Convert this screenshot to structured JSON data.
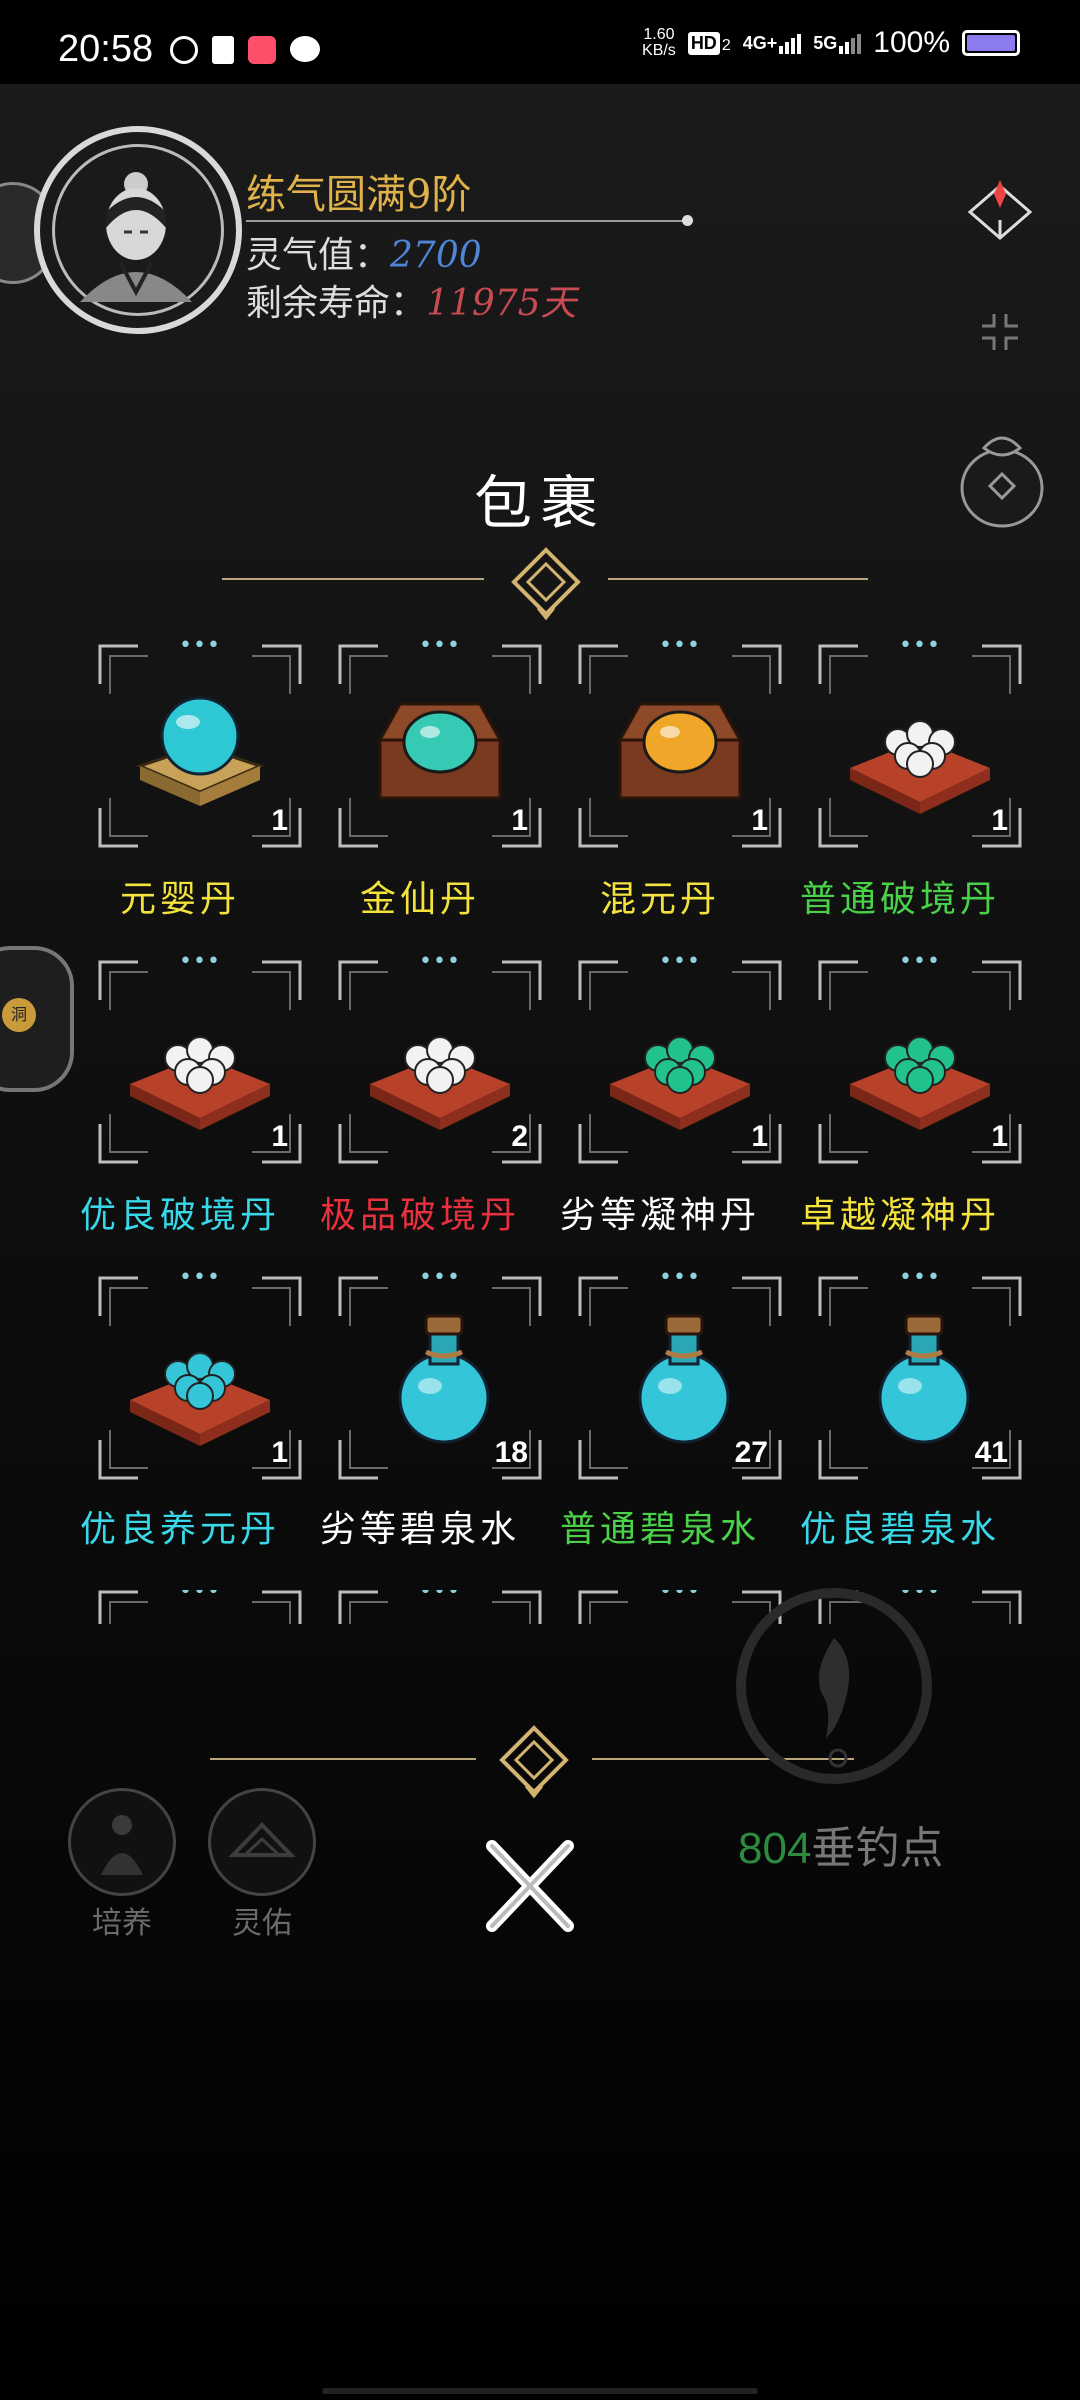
{
  "status_bar": {
    "time": "20:58",
    "net_speed_value": "1.60",
    "net_speed_unit": "KB/s",
    "hd": "HD",
    "hd_sub": "2",
    "sig1": "4G+",
    "sig2": "5G",
    "battery": "100%"
  },
  "player": {
    "rank": "练气圆满9阶",
    "spirit_label": "灵气值：",
    "spirit_value": "2700",
    "life_label": "剩余寿命：",
    "life_value": "11975天"
  },
  "side_tab_label": "洞",
  "panel": {
    "title": "包裹",
    "items": [
      {
        "name": "元婴丹",
        "count": "1",
        "color": "#f3e33c",
        "kind": "orb-box",
        "icon": "cyan-orb-on-box-icon"
      },
      {
        "name": "金仙丹",
        "count": "1",
        "color": "#f3e33c",
        "kind": "chest",
        "orb": "#36c9b4",
        "icon": "teal-orb-chest-icon"
      },
      {
        "name": "混元丹",
        "count": "1",
        "color": "#f3e33c",
        "kind": "chest",
        "orb": "#f0a628",
        "icon": "gold-orb-chest-icon"
      },
      {
        "name": "普通破境丹",
        "count": "1",
        "color": "#4ad14a",
        "kind": "pills",
        "pill": "#f2f2f2",
        "icon": "white-pills-cushion-icon"
      },
      {
        "name": "优良破境丹",
        "count": "1",
        "color": "#38d8e8",
        "kind": "pills",
        "pill": "#f2f2f2",
        "icon": "white-pills-cushion-icon"
      },
      {
        "name": "极品破境丹",
        "count": "2",
        "color": "#e8303e",
        "kind": "pills",
        "pill": "#f2f2f2",
        "icon": "white-pills-cushion-icon"
      },
      {
        "name": "劣等凝神丹",
        "count": "1",
        "color": "#ffffff",
        "kind": "pills",
        "pill": "#22c28f",
        "icon": "green-pills-cushion-icon"
      },
      {
        "name": "卓越凝神丹",
        "count": "1",
        "color": "#f3e33c",
        "kind": "pills",
        "pill": "#22c28f",
        "icon": "green-pills-cushion-icon"
      },
      {
        "name": "优良养元丹",
        "count": "1",
        "color": "#38d8e8",
        "kind": "pills",
        "pill": "#34c6d8",
        "icon": "cyan-pills-cushion-icon"
      },
      {
        "name": "劣等碧泉水",
        "count": "18",
        "color": "#ffffff",
        "kind": "bottle",
        "icon": "potion-bottle-icon"
      },
      {
        "name": "普通碧泉水",
        "count": "27",
        "color": "#4ad14a",
        "kind": "bottle",
        "icon": "potion-bottle-icon"
      },
      {
        "name": "优良碧泉水",
        "count": "41",
        "color": "#38d8e8",
        "kind": "bottle",
        "icon": "potion-bottle-icon"
      }
    ]
  },
  "bottom": {
    "cultivate_label": "培养",
    "blessing_label": "灵佑",
    "fishing_points_value": "804",
    "fishing_points_label": "垂钓点"
  }
}
